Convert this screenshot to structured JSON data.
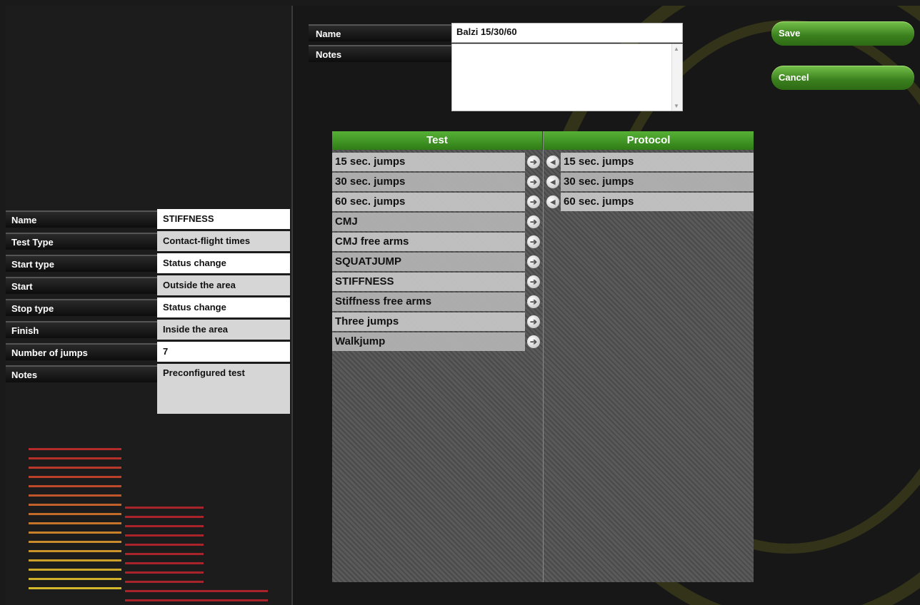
{
  "test_info": {
    "fields": [
      {
        "label": "Name",
        "value": "STIFFNESS"
      },
      {
        "label": "Test Type",
        "value": "Contact-flight times"
      },
      {
        "label": "Start type",
        "value": "Status change"
      },
      {
        "label": "Start",
        "value": "Outside the area"
      },
      {
        "label": "Stop type",
        "value": "Status change"
      },
      {
        "label": "Finish",
        "value": "Inside the area"
      },
      {
        "label": "Number of jumps",
        "value": "7"
      },
      {
        "label": "Notes",
        "value": "Preconfigured test"
      }
    ]
  },
  "protocol": {
    "name_label": "Name",
    "name_value": "Balzi 15/30/60",
    "notes_label": "Notes",
    "notes_value": ""
  },
  "buttons": {
    "save": "Save",
    "cancel": "Cancel"
  },
  "table": {
    "test_header": "Test",
    "protocol_header": "Protocol",
    "tests": [
      "15 sec. jumps",
      "30 sec. jumps",
      "60 sec. jumps",
      "CMJ",
      "CMJ free arms",
      "SQUATJUMP",
      "STIFFNESS",
      "Stiffness free arms",
      "Three jumps",
      "Walkjump"
    ],
    "protocol_items": [
      "15 sec. jumps",
      "30 sec. jumps",
      "60 sec. jumps"
    ]
  },
  "colors": {
    "accent_green": "#3a7f1d",
    "header_green": "#56b136"
  },
  "icons": {
    "add": "arrow-right-icon",
    "remove": "arrow-left-icon"
  }
}
